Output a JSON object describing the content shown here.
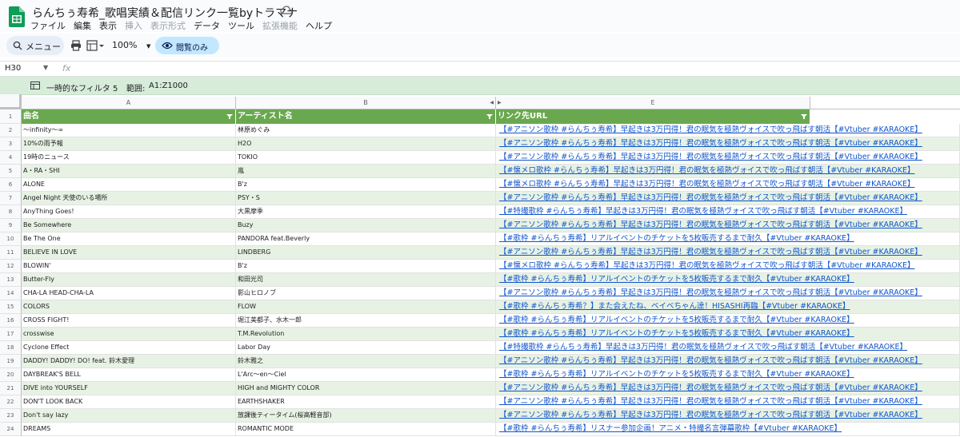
{
  "app": {
    "title": "らんちぅ寿希_歌唱実績＆配信リンク一覧byトラマナ",
    "menu": [
      "ファイル",
      "編集",
      "表示",
      "挿入",
      "表示形式",
      "データ",
      "ツール",
      "拡張機能",
      "ヘルプ"
    ],
    "menu_dim": [
      false,
      false,
      false,
      true,
      true,
      false,
      false,
      true,
      false
    ]
  },
  "toolbar": {
    "menu_label": "メニュー",
    "zoom": "100%",
    "view_only": "閲覧のみ"
  },
  "formula": {
    "cell_ref": "H30",
    "fx": "fx"
  },
  "filter": {
    "label": "一時的なフィルタ 5",
    "range_label": "範囲:",
    "range_value": "A1:Z1000"
  },
  "columns": [
    "A",
    "B",
    "E"
  ],
  "headers": [
    "曲名",
    "アーティスト名",
    "リンク先URL"
  ],
  "rows": [
    {
      "n": "1"
    },
    {
      "n": "2",
      "a": "〜infinity〜∞",
      "b": "林原めぐみ",
      "e": "【#アニソン歌枠 #らんちぅ寿希】早起きは3万円得！君の眠気を極熱ヴォイスで吹っ飛ばす朝活【#Vtuber #KARAOKE】"
    },
    {
      "n": "3",
      "a": "10%の雨予報",
      "b": "H2O",
      "e": "【#アニソン歌枠 #らんちぅ寿希】早起きは3万円得！君の眠気を極熱ヴォイスで吹っ飛ばす朝活【#Vtuber #KARAOKE】"
    },
    {
      "n": "4",
      "a": "19時のニュース",
      "b": "TOKIO",
      "e": "【#アニソン歌枠 #らんちぅ寿希】早起きは3万円得！君の眠気を極熱ヴォイスで吹っ飛ばす朝活【#Vtuber #KARAOKE】"
    },
    {
      "n": "5",
      "a": "A・RA・SHI",
      "b": "嵐",
      "e": "【#懐メロ歌枠 #らんちぅ寿希】早起きは3万円得！君の眠気を極熱ヴォイスで吹っ飛ばす朝活【#Vtuber #KARAOKE】"
    },
    {
      "n": "6",
      "a": "ALONE",
      "b": "B'z",
      "e": "【#懐メロ歌枠 #らんちぅ寿希】早起きは3万円得！君の眠気を極熱ヴォイスで吹っ飛ばす朝活【#Vtuber #KARAOKE】"
    },
    {
      "n": "7",
      "a": "Angel Night 天使のいる場所",
      "b": "PSY・S",
      "e": "【#アニソン歌枠 #らんちぅ寿希】早起きは3万円得！君の眠気を極熱ヴォイスで吹っ飛ばす朝活【#Vtuber #KARAOKE】"
    },
    {
      "n": "8",
      "a": "AnyThing Goes!",
      "b": "大黒摩季",
      "e": "【#特撮歌枠 #らんちぅ寿希】早起きは3万円得！君の眠気を極熱ヴォイスで吹っ飛ばす朝活【#Vtuber #KARAOKE】"
    },
    {
      "n": "9",
      "a": "Be Somewhere",
      "b": "Buzy",
      "e": "【#アニソン歌枠 #らんちぅ寿希】早起きは3万円得！君の眠気を極熱ヴォイスで吹っ飛ばす朝活【#Vtuber #KARAOKE】"
    },
    {
      "n": "10",
      "a": "Be The One",
      "b": "PANDORA feat.Beverly",
      "e": "【#歌枠 #らんちぅ寿希】リアルイベントのチケットを5枚販売するまで耐久【#Vtuber #KARAOKE】"
    },
    {
      "n": "11",
      "a": "BELIEVE IN LOVE",
      "b": "LINDBERG",
      "e": "【#アニソン歌枠 #らんちぅ寿希】早起きは3万円得！君の眠気を極熱ヴォイスで吹っ飛ばす朝活【#Vtuber #KARAOKE】"
    },
    {
      "n": "12",
      "a": "BLOWIN'",
      "b": "B'z",
      "e": "【#懐メロ歌枠 #らんちぅ寿希】早起きは3万円得！君の眠気を極熱ヴォイスで吹っ飛ばす朝活【#Vtuber #KARAOKE】"
    },
    {
      "n": "13",
      "a": "Butter-Fly",
      "b": "和田光司",
      "e": "【#歌枠 #らんちぅ寿希】リアルイベントのチケットを5枚販売するまで耐久【#Vtuber #KARAOKE】"
    },
    {
      "n": "14",
      "a": "CHA-LA HEAD-CHA-LA",
      "b": "影山ヒロノブ",
      "e": "【#アニソン歌枠 #らんちぅ寿希】早起きは3万円得！君の眠気を極熱ヴォイスで吹っ飛ばす朝活【#Vtuber #KARAOKE】"
    },
    {
      "n": "15",
      "a": "COLORS",
      "b": "FLOW",
      "e": "【#歌枠 #らんちぅ寿希？】また会えたね、ベイベちゃん達！HISASHI再臨【#Vtuber #KARAOKE】"
    },
    {
      "n": "16",
      "a": "CROSS FIGHT!",
      "b": "堀江美都子、水木一郎",
      "e": "【#歌枠 #らんちぅ寿希】リアルイベントのチケットを5枚販売するまで耐久【#Vtuber #KARAOKE】"
    },
    {
      "n": "17",
      "a": "crosswise",
      "b": "T.M.Revolution",
      "e": "【#歌枠 #らんちぅ寿希】リアルイベントのチケットを5枚販売するまで耐久【#Vtuber #KARAOKE】"
    },
    {
      "n": "18",
      "a": "Cyclone Effect",
      "b": "Labor Day",
      "e": "【#特撮歌枠 #らんちぅ寿希】早起きは3万円得！君の眠気を極熱ヴォイスで吹っ飛ばす朝活【#Vtuber #KARAOKE】"
    },
    {
      "n": "19",
      "a": "DADDY! DADDY! DO! feat. 鈴木愛理",
      "b": "鈴木雅之",
      "e": "【#アニソン歌枠 #らんちぅ寿希】早起きは3万円得！君の眠気を極熱ヴォイスで吹っ飛ばす朝活【#Vtuber #KARAOKE】"
    },
    {
      "n": "20",
      "a": "DAYBREAK'S BELL",
      "b": "L'Arc〜en〜Ciel",
      "e": "【#歌枠 #らんちぅ寿希】リアルイベントのチケットを5枚販売するまで耐久【#Vtuber #KARAOKE】"
    },
    {
      "n": "21",
      "a": "DIVE into YOURSELF",
      "b": "HIGH and MIGHTY COLOR",
      "e": "【#アニソン歌枠 #らんちぅ寿希】早起きは3万円得！君の眠気を極熱ヴォイスで吹っ飛ばす朝活【#Vtuber #KARAOKE】"
    },
    {
      "n": "22",
      "a": "DON'T LOOK BACK",
      "b": "EARTHSHAKER",
      "e": "【#アニソン歌枠 #らんちぅ寿希】早起きは3万円得！君の眠気を極熱ヴォイスで吹っ飛ばす朝活【#Vtuber #KARAOKE】"
    },
    {
      "n": "23",
      "a": "Don't say lazy",
      "b": "放課後ティータイム(桜高軽音部)",
      "e": "【#アニソン歌枠 #らんちぅ寿希】早起きは3万円得！君の眠気を極熱ヴォイスで吹っ飛ばす朝活【#Vtuber #KARAOKE】"
    },
    {
      "n": "24",
      "a": "DREAMS",
      "b": "ROMANTIC MODE",
      "e": "【#歌枠 #らんちぅ寿希】リスナー参加企画！アニメ・特撮名言弾幕歌枠【#Vtuber #KARAOKE】"
    }
  ],
  "colors": {
    "header_green": "#6aa84f",
    "alt_row": "#e7f2e4",
    "filter_bar": "#d7ecd9",
    "link": "#1155cc"
  }
}
